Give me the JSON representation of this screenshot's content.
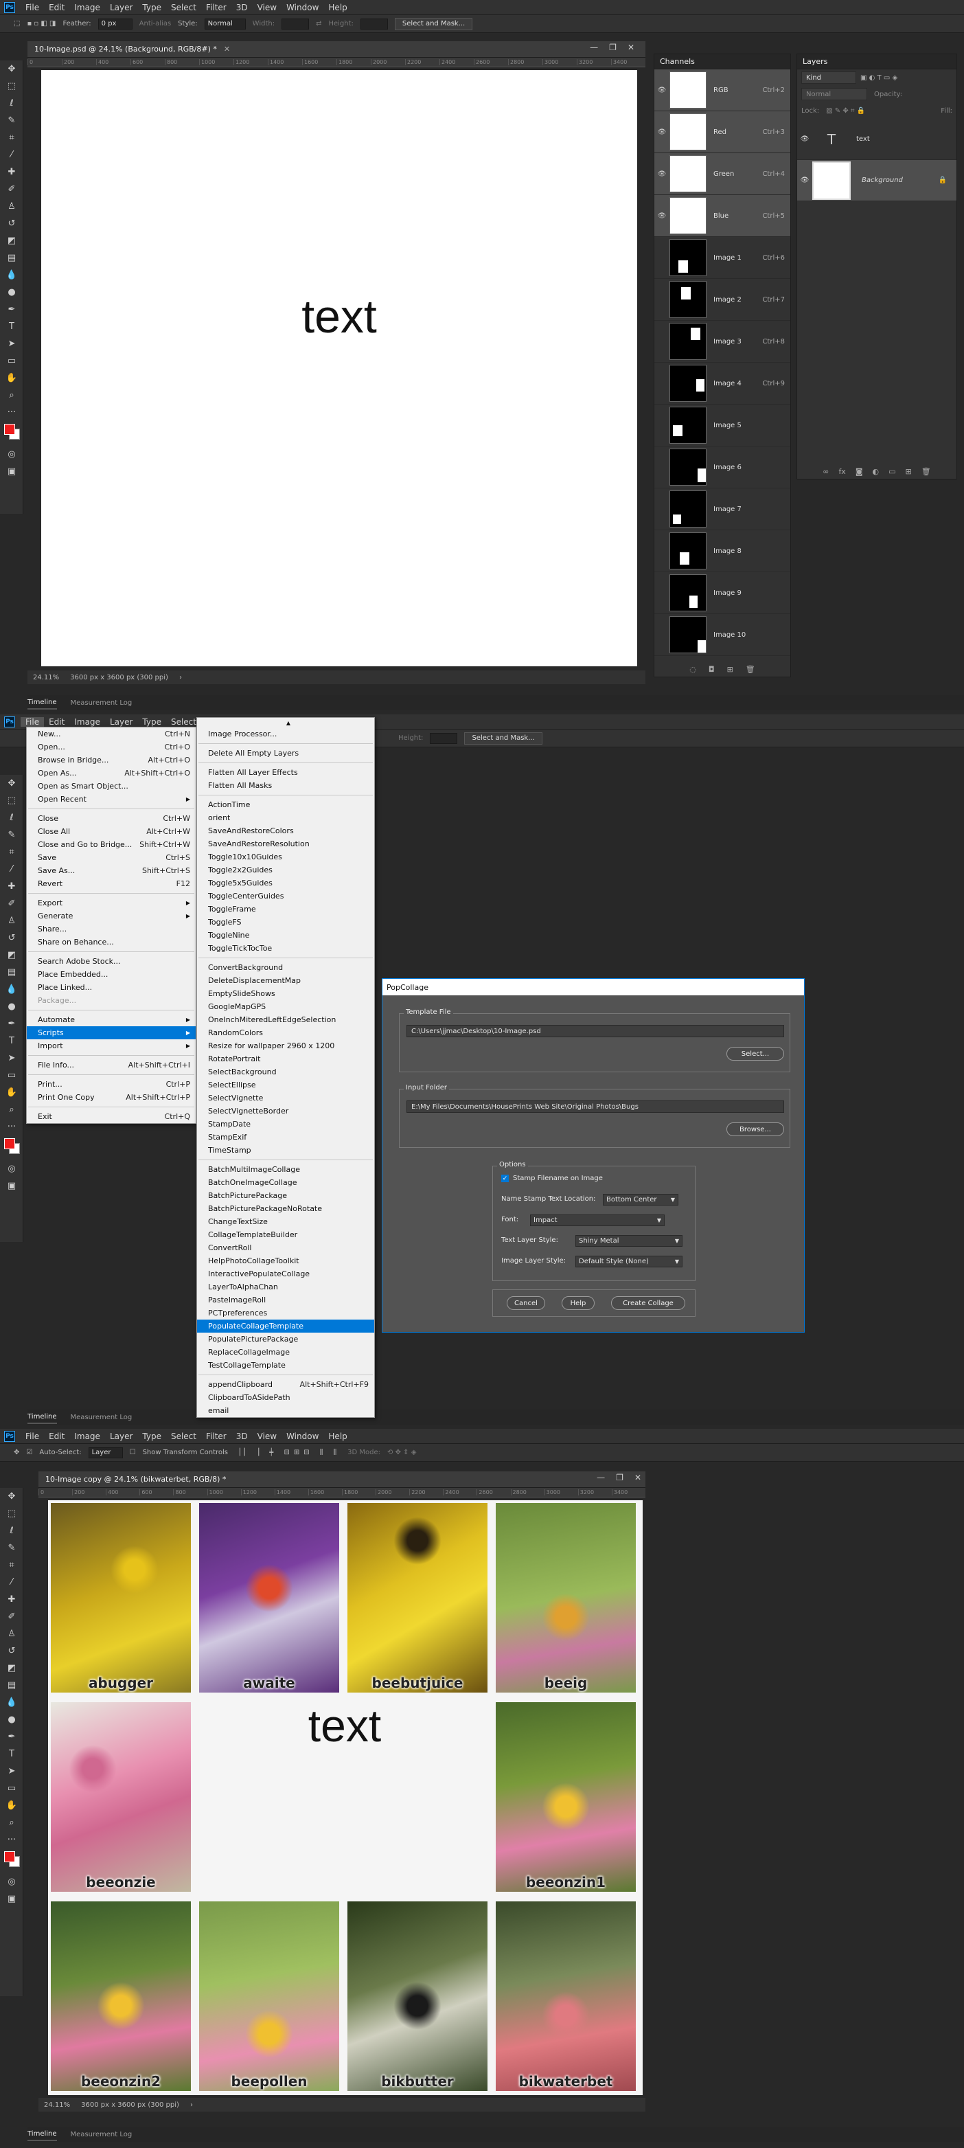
{
  "menus": [
    "File",
    "Edit",
    "Image",
    "Layer",
    "Type",
    "Select",
    "Filter",
    "3D",
    "View",
    "Window",
    "Help"
  ],
  "shot1": {
    "options": {
      "feather_label": "Feather:",
      "feather_value": "0 px",
      "antialias": "Anti-alias",
      "style_label": "Style:",
      "style_value": "Normal",
      "width_label": "Width:",
      "height_label": "Height:",
      "select_mask": "Select and Mask..."
    },
    "doc_tab": "10-Image.psd @ 24.1% (Background, RGB/8#) *",
    "ruler": [
      "0",
      "200",
      "400",
      "600",
      "800",
      "1000",
      "1200",
      "1400",
      "1600",
      "1800",
      "2000",
      "2200",
      "2400",
      "2600",
      "2800",
      "3000",
      "3200",
      "3400"
    ],
    "canvas_text": "text",
    "status_zoom": "24.11%",
    "status_size": "3600 px x 3600 px (300 ppi)",
    "channels_title": "Channels",
    "channels": [
      {
        "name": "RGB",
        "shortcut": "Ctrl+2"
      },
      {
        "name": "Red",
        "shortcut": "Ctrl+3"
      },
      {
        "name": "Green",
        "shortcut": "Ctrl+4"
      },
      {
        "name": "Blue",
        "shortcut": "Ctrl+5"
      },
      {
        "name": "Image 1",
        "shortcut": "Ctrl+6"
      },
      {
        "name": "Image 2",
        "shortcut": "Ctrl+7"
      },
      {
        "name": "Image 3",
        "shortcut": "Ctrl+8"
      },
      {
        "name": "Image 4",
        "shortcut": "Ctrl+9"
      },
      {
        "name": "Image 5",
        "shortcut": ""
      },
      {
        "name": "Image 6",
        "shortcut": ""
      },
      {
        "name": "Image 7",
        "shortcut": ""
      },
      {
        "name": "Image 8",
        "shortcut": ""
      },
      {
        "name": "Image 9",
        "shortcut": ""
      },
      {
        "name": "Image 10",
        "shortcut": ""
      }
    ],
    "layers_title": "Layers",
    "layers_kind": "Kind",
    "layers_blend": "Normal",
    "layers_opacity": "Opacity:",
    "layers_fill": "Fill:",
    "layers_lock": "Lock:",
    "layers": [
      {
        "name": "text"
      },
      {
        "name": "Background"
      }
    ],
    "bottom_tabs": [
      "Timeline",
      "Measurement Log"
    ]
  },
  "shot2": {
    "file_menu": [
      {
        "label": "New...",
        "sc": "Ctrl+N"
      },
      {
        "label": "Open...",
        "sc": "Ctrl+O"
      },
      {
        "label": "Browse in Bridge...",
        "sc": "Alt+Ctrl+O"
      },
      {
        "label": "Open As...",
        "sc": "Alt+Shift+Ctrl+O"
      },
      {
        "label": "Open as Smart Object...",
        "sc": ""
      },
      {
        "label": "Open Recent",
        "sc": ""
      },
      {
        "label": "Close",
        "sc": "Ctrl+W"
      },
      {
        "label": "Close All",
        "sc": "Alt+Ctrl+W"
      },
      {
        "label": "Close and Go to Bridge...",
        "sc": "Shift+Ctrl+W"
      },
      {
        "label": "Save",
        "sc": "Ctrl+S"
      },
      {
        "label": "Save As...",
        "sc": "Shift+Ctrl+S"
      },
      {
        "label": "Revert",
        "sc": "F12"
      },
      {
        "label": "Export",
        "sc": ""
      },
      {
        "label": "Generate",
        "sc": ""
      },
      {
        "label": "Share...",
        "sc": ""
      },
      {
        "label": "Share on Behance...",
        "sc": ""
      },
      {
        "label": "Search Adobe Stock...",
        "sc": ""
      },
      {
        "label": "Place Embedded...",
        "sc": ""
      },
      {
        "label": "Place Linked...",
        "sc": ""
      },
      {
        "label": "Package...",
        "sc": ""
      },
      {
        "label": "Automate",
        "sc": ""
      },
      {
        "label": "Scripts",
        "sc": ""
      },
      {
        "label": "Import",
        "sc": ""
      },
      {
        "label": "File Info...",
        "sc": "Alt+Shift+Ctrl+I"
      },
      {
        "label": "Print...",
        "sc": "Ctrl+P"
      },
      {
        "label": "Print One Copy",
        "sc": "Alt+Shift+Ctrl+P"
      },
      {
        "label": "Exit",
        "sc": "Ctrl+Q"
      }
    ],
    "scripts_menu": [
      "Image Processor...",
      "Delete All Empty Layers",
      "Flatten All Layer Effects",
      "Flatten All Masks",
      "ActionTime",
      "orient",
      "SaveAndRestoreColors",
      "SaveAndRestoreResolution",
      "Toggle10x10Guides",
      "Toggle2x2Guides",
      "Toggle5x5Guides",
      "ToggleCenterGuides",
      "ToggleFrame",
      "ToggleFS",
      "ToggleNine",
      "ToggleTickTocToe",
      "ConvertBackground",
      "DeleteDisplacementMap",
      "EmptySlideShows",
      "GoogleMapGPS",
      "OneInchMiteredLeftEdgeSelection",
      "RandomColors",
      "Resize for wallpaper 2960 x 1200",
      "RotatePortrait",
      "SelectBackground",
      "SelectEllipse",
      "SelectVignette",
      "SelectVignetteBorder",
      "StampDate",
      "StampExif",
      "TimeStamp",
      "BatchMultiImageCollage",
      "BatchOneImageCollage",
      "BatchPicturePackage",
      "BatchPicturePackageNoRotate",
      "ChangeTextSize",
      "CollageTemplateBuilder",
      "ConvertRoll",
      "HelpPhotoCollageToolkit",
      "InteractivePopulateCollage",
      "LayerToAlphaChan",
      "PasteImageRoll",
      "PCTpreferences",
      "PopulateCollageTemplate",
      "PopulatePicturePackage",
      "ReplaceCollageImage",
      "TestCollageTemplate",
      "appendClipboard",
      "ClipboardToASidePath",
      "email"
    ],
    "scripts_sc": {
      "appendClipboard": "Alt+Shift+Ctrl+F9"
    },
    "options_height": "Height:",
    "options_select_mask": "Select and Mask...",
    "dialog": {
      "title": "PopCollage",
      "template_group": "Template File",
      "template_path": "C:\\Users\\jjmac\\Desktop\\10-Image.psd",
      "select_btn": "Select...",
      "input_group": "Input Folder",
      "input_path": "E:\\My Files\\Documents\\HousePrints Web Site\\Original Photos\\Bugs",
      "browse_btn": "Browse...",
      "options_group": "Options",
      "stamp_label": "Stamp Filename on Image",
      "location_label": "Name Stamp Text  Location:",
      "location_value": "Bottom Center",
      "font_label": "Font:",
      "font_value": "Impact",
      "text_style_label": "Text Layer Style:",
      "text_style_value": "Shiny Metal",
      "image_style_label": "Image Layer Style:",
      "image_style_value": "Default Style (None)",
      "cancel": "Cancel",
      "help": "Help",
      "create": "Create Collage"
    }
  },
  "shot3": {
    "options": {
      "auto_select": "Auto-Select:",
      "layer_value": "Layer",
      "show_transform": "Show Transform Controls",
      "mode_3d": "3D Mode:"
    },
    "doc_tab": "10-Image copy @ 24.1% (bikwaterbet, RGB/8) *",
    "canvas_text": "text",
    "captions": [
      "abugger",
      "awaite",
      "beebutjuice",
      "beeig",
      "beeonzie",
      "beeonzin1",
      "beeonzin2",
      "beepollen",
      "bikbutter",
      "bikwaterbet"
    ],
    "status_zoom": "24.11%",
    "status_size": "3600 px x 3600 px (300 ppi)"
  },
  "colors": {
    "accent": "#0078d7",
    "fg": "#ee1c1c",
    "bg": "#ffffff"
  }
}
